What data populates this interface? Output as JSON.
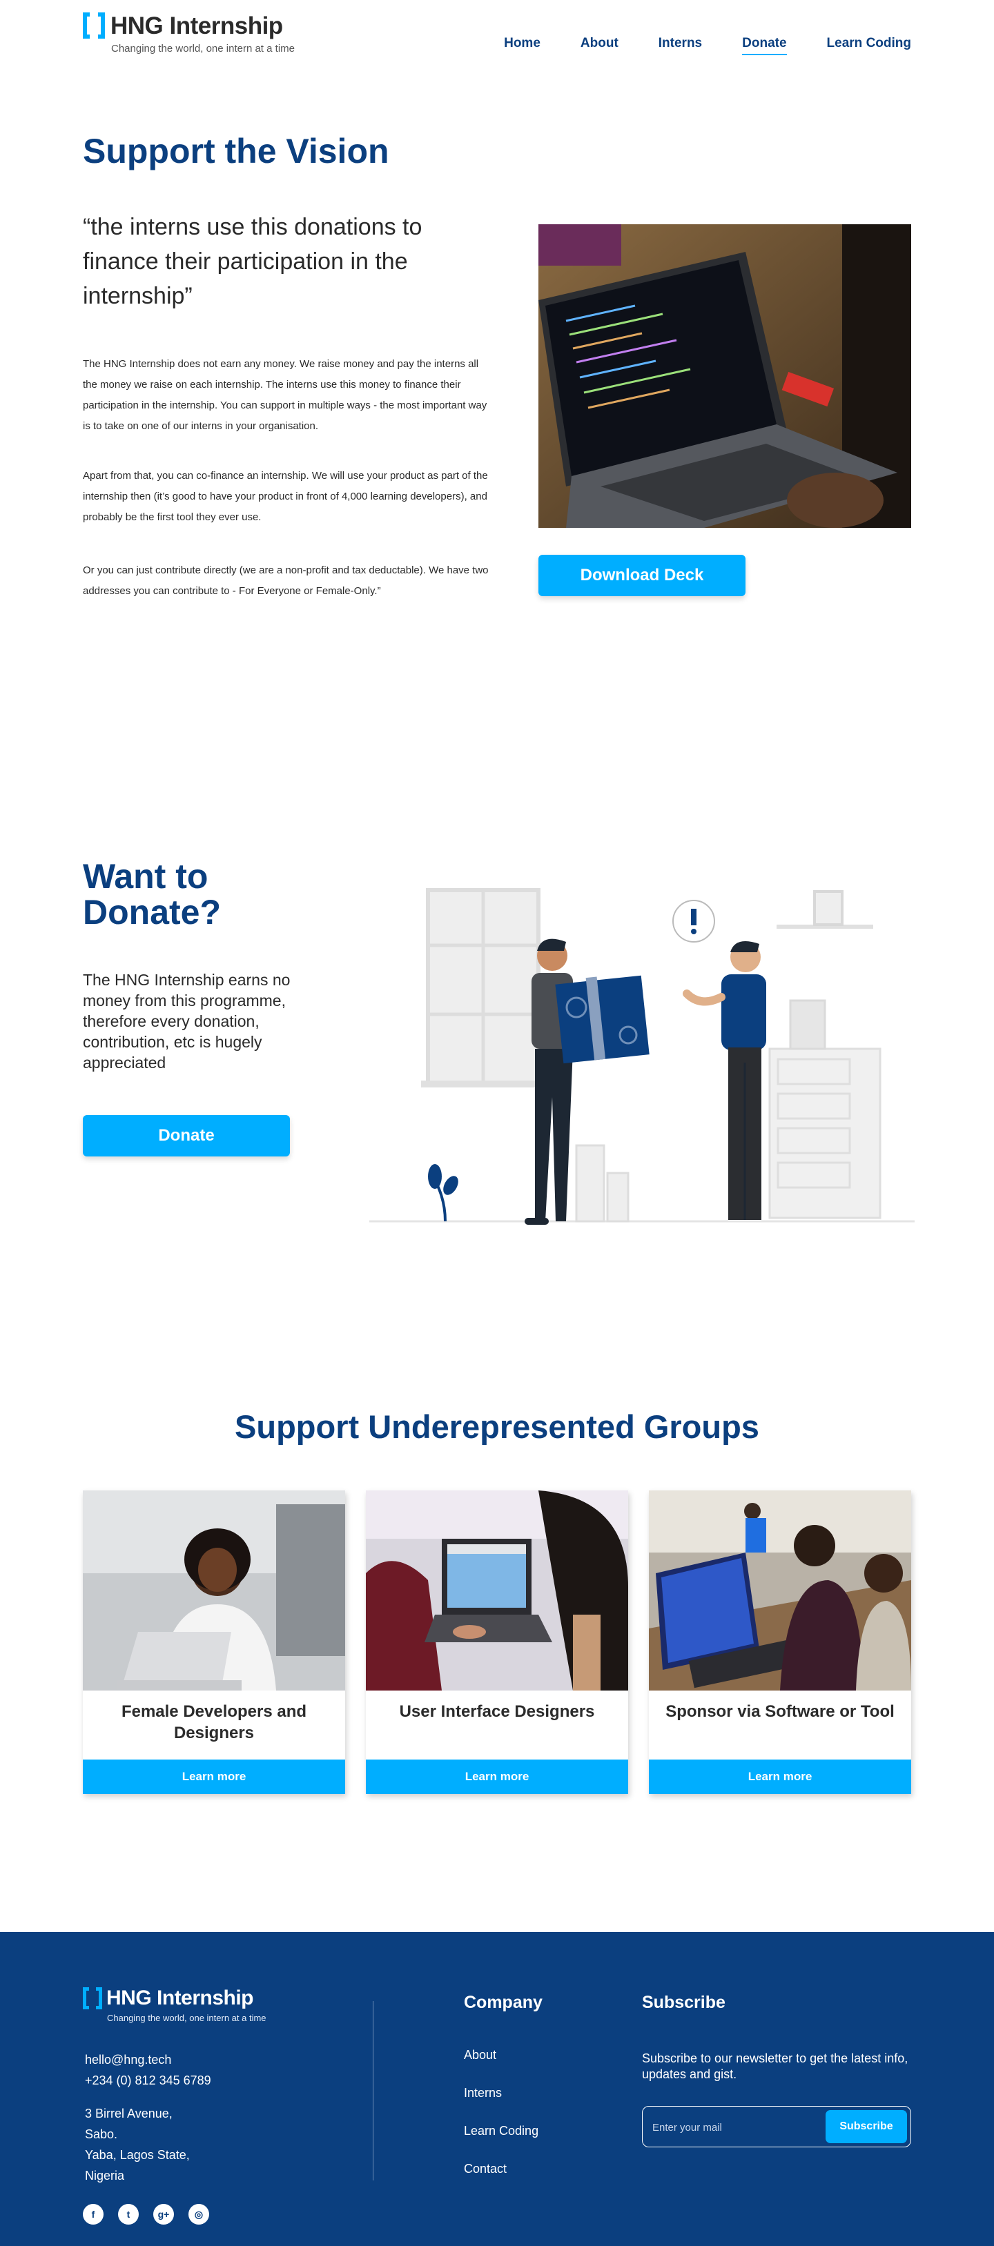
{
  "brand": {
    "name": "HNG Internship",
    "tagline": "Changing the world, one intern at a time"
  },
  "nav": {
    "items": [
      {
        "label": "Home"
      },
      {
        "label": "About"
      },
      {
        "label": "Interns"
      },
      {
        "label": "Donate",
        "active": true
      },
      {
        "label": "Learn Coding"
      }
    ]
  },
  "hero": {
    "title": "Support the Vision",
    "quote": "“the interns use this donations to finance their participation in the internship”",
    "paragraphs": [
      "The HNG Internship does not earn any money. We raise money and pay the interns all the money we raise on each internship. The interns use this money to finance their participation in the internship. You can support in multiple ways - the most important way is to take on one of our interns in your organisation.",
      "Apart from that, you can co-finance an internship. We will use your product as part of the internship then (it’s good to have your product in front of 4,000 learning developers), and probably be the first tool they ever use.",
      "Or you can just contribute directly (we are a non-profit and tax deductable). We have two addresses you can contribute to - For Everyone or Female-Only.”"
    ],
    "download_button": "Download Deck"
  },
  "donate": {
    "title": "Want to Donate?",
    "text": "The HNG Internship earns no money from this programme, therefore every donation, contribution, etc is hugely appreciated",
    "button": "Donate"
  },
  "groups": {
    "title": "Support Underepresented Groups",
    "cards": [
      {
        "title": "Female Developers and Designers",
        "button": "Learn more"
      },
      {
        "title": "User Interface Designers",
        "button": "Learn more"
      },
      {
        "title": "Sponsor via Software or Tool",
        "button": "Learn more"
      }
    ]
  },
  "footer": {
    "email": "hello@hng.tech",
    "phone": "+234 (0) 812 345 6789",
    "address": [
      "3 Birrel Avenue,",
      "Sabo.",
      "Yaba, Lagos State,",
      "Nigeria"
    ],
    "social": [
      {
        "icon": "facebook-icon",
        "glyph": "f"
      },
      {
        "icon": "twitter-icon",
        "glyph": "t"
      },
      {
        "icon": "google-plus-icon",
        "glyph": "g+"
      },
      {
        "icon": "instagram-icon",
        "glyph": "◎"
      }
    ],
    "company_title": "Company",
    "company_links": [
      "About",
      "Interns",
      "Learn Coding",
      "Contact"
    ],
    "subscribe_title": "Subscribe",
    "subscribe_text": "Subscribe to our newsletter to get the latest info, updates and gist.",
    "subscribe_placeholder": "Enter your mail",
    "subscribe_button": "Subscribe"
  },
  "colors": {
    "primary": "#0b3f7f",
    "accent": "#00aeff",
    "text": "#2a2a2a"
  }
}
